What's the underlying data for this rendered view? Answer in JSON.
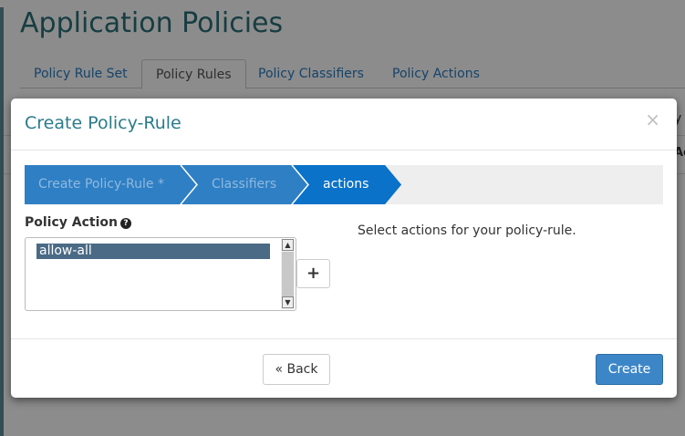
{
  "background": {
    "title": "Application Policies",
    "tabs": [
      {
        "label": "Policy Rule Set"
      },
      {
        "label": "Policy Rules"
      },
      {
        "label": "Policy Classifiers"
      },
      {
        "label": "Policy Actions"
      }
    ],
    "active_tab": "Policy Rules",
    "right_fragment_1": "y",
    "right_fragment_2": "Ac"
  },
  "modal": {
    "title": "Create Policy-Rule",
    "close_symbol": "×",
    "wizard_steps": [
      {
        "label": "Create Policy-Rule *",
        "state": "done"
      },
      {
        "label": "Classifiers",
        "state": "done"
      },
      {
        "label": "actions",
        "state": "current"
      }
    ],
    "field_label": "Policy Action",
    "help_symbol": "?",
    "options": [
      "allow-all"
    ],
    "selected_option": "allow-all",
    "add_symbol": "+",
    "help_text": "Select actions for your policy-rule.",
    "back_label": "« Back",
    "create_label": "Create"
  },
  "colors": {
    "step_done": "#2f7fc4",
    "step_current": "#0a72c9",
    "step_done_text": "#8fb9de",
    "step_current_text": "#ffffff",
    "primary_button": "#3c86c8",
    "title_teal": "#2a7b8a"
  }
}
